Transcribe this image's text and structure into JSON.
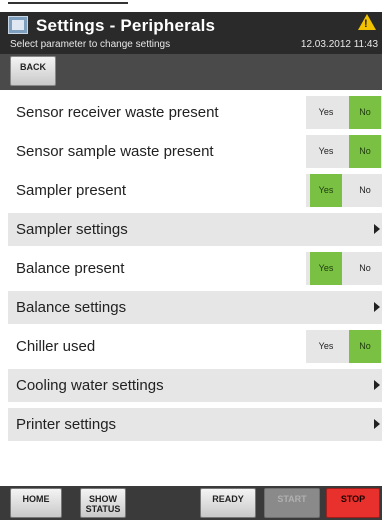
{
  "header": {
    "title": "Settings - Peripherals",
    "subtitle": "Select parameter to change settings",
    "datetime": "12.03.2012 11:43",
    "warning_icon": "warning-icon"
  },
  "toolbar": {
    "back_label": "BACK"
  },
  "rows": [
    {
      "label": "Sensor receiver waste present",
      "type": "toggle",
      "yes": "Yes",
      "no": "No",
      "selected": "No"
    },
    {
      "label": "Sensor sample waste present",
      "type": "toggle",
      "yes": "Yes",
      "no": "No",
      "selected": "No"
    },
    {
      "label": "Sampler present",
      "type": "toggle",
      "yes": "Yes",
      "no": "No",
      "selected": "Yes"
    },
    {
      "label": "Sampler settings",
      "type": "nav"
    },
    {
      "label": "Balance present",
      "type": "toggle",
      "yes": "Yes",
      "no": "No",
      "selected": "Yes"
    },
    {
      "label": "Balance settings",
      "type": "nav"
    },
    {
      "label": "Chiller used",
      "type": "toggle",
      "yes": "Yes",
      "no": "No",
      "selected": "No"
    },
    {
      "label": "Cooling water settings",
      "type": "nav"
    },
    {
      "label": "Printer settings",
      "type": "nav"
    }
  ],
  "bottom": {
    "home": "HOME",
    "show_status_1": "SHOW",
    "show_status_2": "STATUS",
    "ready": "READY",
    "start": "START",
    "stop": "STOP"
  },
  "colors": {
    "selected_green": "#7ac143",
    "stop_red": "#e8302c",
    "header_dark": "#2a2a2a"
  }
}
